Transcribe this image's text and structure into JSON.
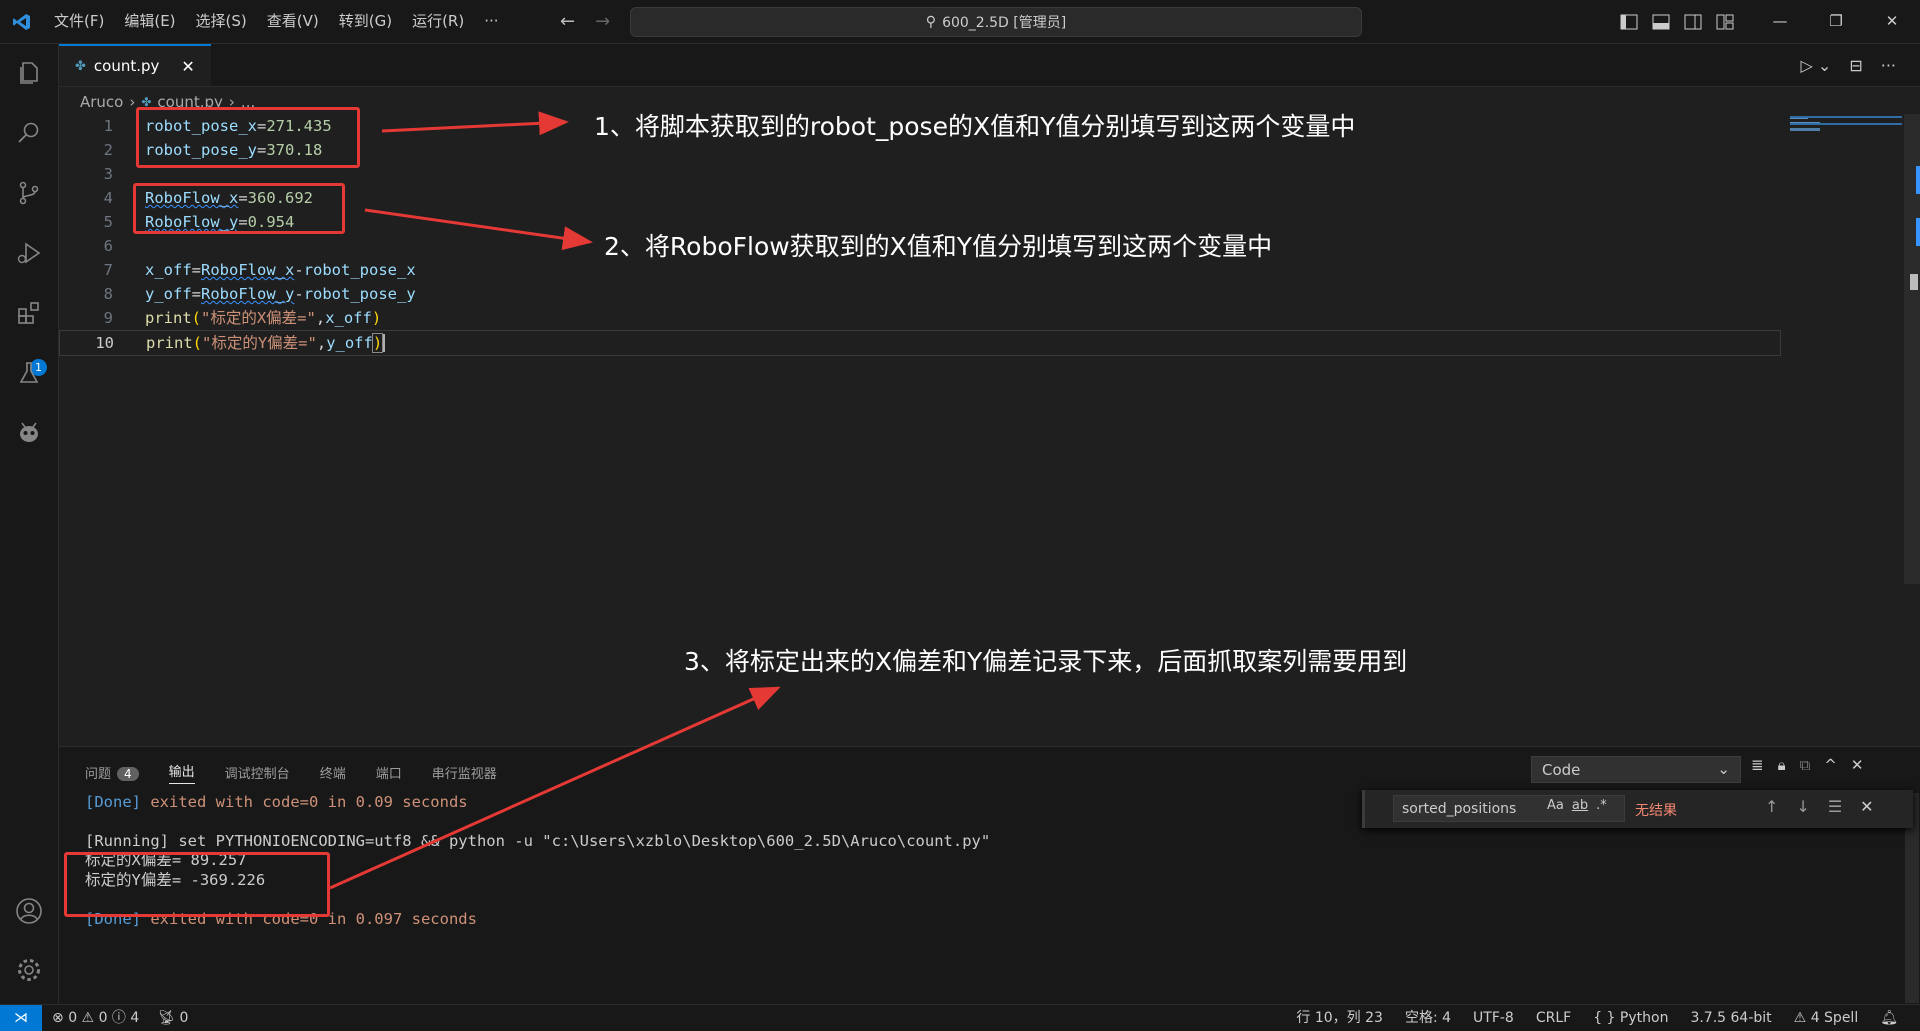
{
  "titlebar": {
    "menu": [
      "文件(F)",
      "编辑(E)",
      "选择(S)",
      "查看(V)",
      "转到(G)",
      "运行(R)",
      "···"
    ],
    "search_text": "600_2.5D [管理员]"
  },
  "tab": {
    "filename": "count.py",
    "close": "✕"
  },
  "breadcrumb": {
    "folder": "Aruco",
    "file": "count.py",
    "more": "..."
  },
  "editor": {
    "line_numbers": [
      "1",
      "2",
      "3",
      "4",
      "5",
      "6",
      "7",
      "8",
      "9",
      "10"
    ],
    "lines": {
      "l1_var": "robot_pose_x",
      "l1_val": "271.435",
      "l2_var": "robot_pose_y",
      "l2_val": "370.18",
      "l4_var": "RoboFlow_x",
      "l4_val": "360.692",
      "l5_var": "RoboFlow_y",
      "l5_val": "0.954",
      "l7_a": "x_off",
      "l7_b": "RoboFlow_x",
      "l7_c": "robot_pose_x",
      "l8_a": "y_off",
      "l8_b": "RoboFlow_y",
      "l8_c": "robot_pose_y",
      "l9_fn": "print",
      "l9_str": "\"标定的X偏差=\"",
      "l9_arg": "x_off",
      "l10_fn": "print",
      "l10_str": "\"标定的Y偏差=\"",
      "l10_arg": "y_off"
    }
  },
  "annotations": {
    "a1": "1、将脚本获取到的robot_pose的X值和Y值分别填写到这两个变量中",
    "a2": "2、将RoboFlow获取到的X值和Y值分别填写到这两个变量中",
    "a3": "3、将标定出来的X偏差和Y偏差记录下来，后面抓取案列需要用到"
  },
  "panel": {
    "tabs": [
      "问题",
      "输出",
      "调试控制台",
      "终端",
      "端口",
      "串行监视器"
    ],
    "problems_count": "4",
    "channel": "Code",
    "output": {
      "done1_tag": "[Done]",
      "done1_text": "exited with code=0 in 0.09 seconds",
      "running_tag": "[Running]",
      "running_text": "set PYTHONIOENCODING=utf8 && python -u \"c:\\Users\\xzblo\\Desktop\\600_2.5D\\Aruco\\count.py\"",
      "result_x": "标定的X偏差= 89.257",
      "result_y": "标定的Y偏差= -369.226",
      "done2_tag": "[Done]",
      "done2_text": "exited with code=0 in 0.097 seconds"
    },
    "find": {
      "value": "sorted_positions",
      "opt_case": "Aa",
      "opt_word": "ab",
      "opt_regex": ".*",
      "no_results": "无结果"
    }
  },
  "statusbar": {
    "errors": "0",
    "warnings": "0",
    "infos": "4",
    "ports": "0",
    "position": "行 10，列 23",
    "spaces": "空格: 4",
    "encoding": "UTF-8",
    "eol": "CRLF",
    "language": "Python",
    "interpreter": "3.7.5 64-bit",
    "spell": "4 Spell"
  },
  "colors": {
    "accent": "#0078d4",
    "annotation_red": "#e53935"
  }
}
